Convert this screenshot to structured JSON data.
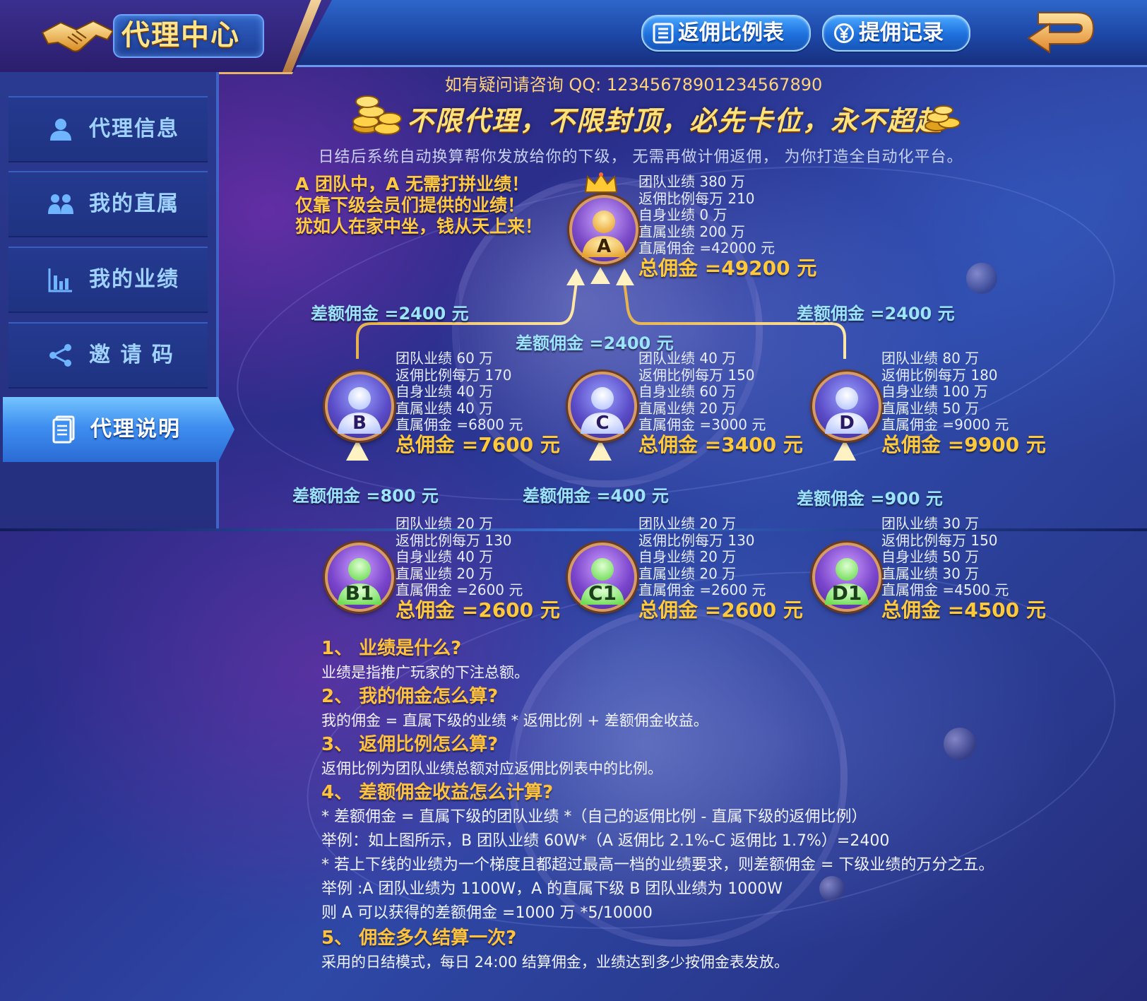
{
  "header": {
    "title": "代理中心",
    "btn_rate_table": "返佣比例表",
    "btn_records": "提佣记录",
    "colors": {
      "gold": "#ffc93a",
      "blue": "#1e6fdc",
      "cyan": "#9be3ff"
    }
  },
  "sidebar": {
    "items": [
      {
        "label": "代理信息",
        "icon": "user-icon"
      },
      {
        "label": "我的直属",
        "icon": "users-icon"
      },
      {
        "label": "我的业绩",
        "icon": "bar-chart-icon"
      },
      {
        "label": "邀 请 码",
        "icon": "share-icon"
      },
      {
        "label": "代理说明",
        "icon": "document-icon",
        "active": true
      }
    ]
  },
  "intro": {
    "qq": "如有疑问请咨询 QQ: 12345678901234567890",
    "slogan": "不限代理，不限封顶，必先卡位，永不超越",
    "desc": "日结后系统自动换算帮你发放给你的下级， 无需再做计佣返佣， 为你打造全自动化平台。",
    "promo": [
      "A 团队中，A 无需打拼业绩！",
      "仅靠下级会员们提供的业绩！",
      "犹如人在家中坐，钱从天上来！"
    ]
  },
  "tree": {
    "a": {
      "label": "A",
      "lines": [
        "团队业绩 380 万",
        "返佣比例每万 210",
        "自身业绩 0 万",
        "直属业绩 200 万",
        "直属佣金 =42000 元"
      ],
      "total": "总佣金 =49200 元"
    },
    "b": {
      "label": "B",
      "lines": [
        "团队业绩 60 万",
        "返佣比例每万 170",
        "自身业绩 40 万",
        "直属业绩 40 万",
        "直属佣金 =6800 元"
      ],
      "total": "总佣金 =7600 元"
    },
    "c": {
      "label": "C",
      "lines": [
        "团队业绩 40 万",
        "返佣比例每万 150",
        "自身业绩 60 万",
        "直属业绩 20 万",
        "直属佣金 =3000 元"
      ],
      "total": "总佣金 =3400 元"
    },
    "d": {
      "label": "D",
      "lines": [
        "团队业绩 80 万",
        "返佣比例每万 180",
        "自身业绩 100 万",
        "直属业绩 50 万",
        "直属佣金 =9000 元"
      ],
      "total": "总佣金 =9900 元"
    },
    "b1": {
      "label": "B1",
      "lines": [
        "团队业绩 20 万",
        "返佣比例每万 130",
        "自身业绩 40 万",
        "直属业绩 20 万",
        "直属佣金 =2600 元"
      ],
      "total": "总佣金 =2600 元"
    },
    "c1": {
      "label": "C1",
      "lines": [
        "团队业绩 20 万",
        "返佣比例每万 130",
        "自身业绩 20 万",
        "直属业绩 20 万",
        "直属佣金 =2600 元"
      ],
      "total": "总佣金 =2600 元"
    },
    "d1": {
      "label": "D1",
      "lines": [
        "团队业绩 30 万",
        "返佣比例每万 150",
        "自身业绩 50 万",
        "直属业绩 30 万",
        "直属佣金 =4500 元"
      ],
      "total": "总佣金 =4500 元"
    },
    "diff": {
      "ab": "差额佣金 =2400 元",
      "ac": "差额佣金 =2400 元",
      "ad": "差额佣金 =2400 元",
      "bb1": "差额佣金 =800 元",
      "cc1": "差额佣金 =400 元",
      "dd1": "差额佣金 =900 元"
    }
  },
  "faq": [
    {
      "q": "1、  业绩是什么?",
      "a": [
        "业绩是指推广玩家的下注总额。"
      ]
    },
    {
      "q": "2、  我的佣金怎么算?",
      "a": [
        "我的佣金 = 直属下级的业绩 * 返佣比例 + 差额佣金收益。"
      ]
    },
    {
      "q": "3、  返佣比例怎么算?",
      "a": [
        "返佣比例为团队业绩总额对应返佣比例表中的比例。"
      ]
    },
    {
      "q": "4、  差额佣金收益怎么计算?",
      "a": [
        "* 差额佣金 = 直属下级的团队业绩 *（自己的返佣比例 - 直属下级的返佣比例）",
        "举例：如上图所示，B 团队业绩 60W*（A 返佣比 2.1%-C 返佣比 1.7%）=2400",
        "* 若上下线的业绩为一个梯度且都超过最高一档的业绩要求，则差额佣金 = 下级业绩的万分之五。",
        "举例 :A 团队业绩为 1100W，A 的直属下级 B 团队业绩为 1000W",
        "则 A 可以获得的差额佣金 =1000 万 *5/10000"
      ]
    },
    {
      "q": "5、  佣金多久结算一次?",
      "a": [
        "采用的日结模式，每日 24:00 结算佣金，业绩达到多少按佣金表发放。"
      ]
    }
  ]
}
